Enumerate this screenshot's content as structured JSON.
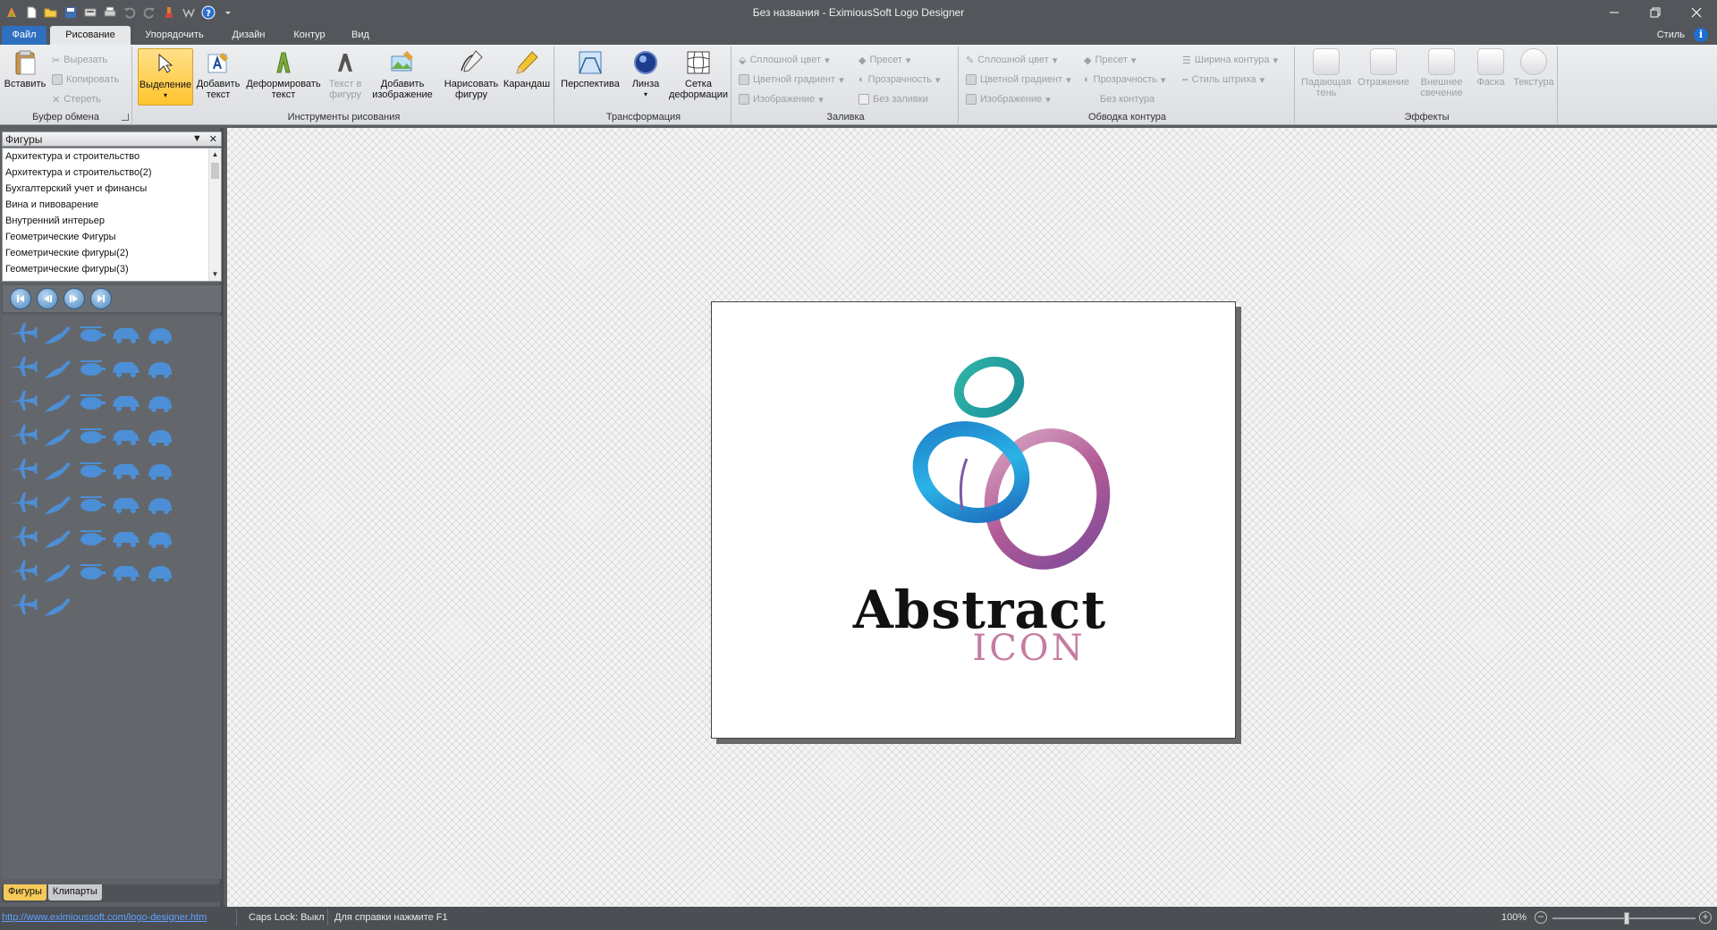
{
  "window": {
    "title": "Без названия - EximiousSoft Logo Designer",
    "controls": [
      "minimize-icon",
      "restore-icon",
      "close-icon"
    ]
  },
  "quick_access": [
    "app-logo-icon",
    "new-file-icon",
    "open-file-icon",
    "save-icon",
    "save-as-icon",
    "print-icon",
    "undo-icon",
    "redo-icon",
    "paint-icon",
    "web-icon",
    "help-icon",
    "qat-dropdown-icon"
  ],
  "tabs": {
    "file": "Файл",
    "items": [
      "Рисование",
      "Упорядочить",
      "Дизайн",
      "Контур",
      "Вид"
    ],
    "active": "Рисование",
    "style_menu": "Стиль"
  },
  "ribbon": {
    "clipboard": {
      "title": "Буфер обмена",
      "paste": "Вставить",
      "cut": "Вырезать",
      "copy": "Копировать",
      "delete": "Стереть"
    },
    "drawing": {
      "title": "Инструменты рисования",
      "select": "Выделение",
      "add_text": "Добавить текст",
      "warp_text": "Деформировать текст",
      "text_in_shape": "Текст в фигуру",
      "add_image": "Добавить изображение",
      "draw_shape": "Нарисовать фигуру",
      "pencil": "Карандаш"
    },
    "transform": {
      "title": "Трансформация",
      "perspective": "Перспектива",
      "lens": "Линза",
      "warp_grid": "Сетка деформации"
    },
    "fill": {
      "title": "Заливка",
      "solid": "Сплошной цвет",
      "gradient": "Цветной градиент",
      "image": "Изображение",
      "preset": "Пресет",
      "transparency": "Прозрачность",
      "no_fill": "Без заливки"
    },
    "stroke": {
      "title": "Обводка контура",
      "solid": "Сплошной цвет",
      "gradient": "Цветной градиент",
      "image": "Изображение",
      "preset": "Пресет",
      "transparency": "Прозрачность",
      "no_stroke": "Без контура",
      "width": "Ширина контура",
      "dash": "Стиль штриха"
    },
    "effects": {
      "title": "Эффекты",
      "shadow": "Падающая тень",
      "reflection": "Отражение",
      "glow": "Внешнее свечение",
      "bevel": "Фаска",
      "texture": "Текстура"
    }
  },
  "shapes_panel": {
    "title": "Фигуры",
    "categories": [
      "Архитектура и строительство",
      "Архитектура и строительство(2)",
      "Бухгалтерский учет и финансы",
      "Вина и пивоварение",
      "Внутренний интерьер",
      "Геометрические Фигуры",
      "Геометрические фигуры(2)",
      "Геометрические фигуры(3)"
    ],
    "nav": [
      "first-page-icon",
      "prev-page-icon",
      "next-page-icon",
      "last-page-icon"
    ],
    "shape_icons": [
      "airplane-icon",
      "jet-icon",
      "helicopter-icon",
      "car-icon",
      "car-side-icon",
      "car-front-icon",
      "car-round-icon",
      "motorcycle-icon",
      "scooter-icon",
      "car-box-icon",
      "tractor-icon",
      "paraglider-icon",
      "motorbike-icon",
      "biplane-icon",
      "truck-icon",
      "boat-icon",
      "airplane-small-icon",
      "motocross-icon",
      "bird-plane-icon",
      "gear-icon",
      "van-icon",
      "bus-icon",
      "lorry-icon",
      "sedan-icon",
      "biker-icon",
      "forklift-icon",
      "coach-icon",
      "fighter-jet-icon",
      "fish-plane-icon",
      "rocket-icon",
      "scuba-icon",
      "glider-icon",
      "bicycle-icon",
      "tram-icon",
      "ambulance-icon",
      "seaplane-icon",
      "parrot-icon",
      "ufo-icon",
      "ship-icon",
      "taxi-icon",
      "train-icon",
      "trolleybus-icon"
    ],
    "bottom_tabs": [
      "Фигуры",
      "Клипарты"
    ],
    "active_bottom_tab": "Фигуры"
  },
  "canvas": {
    "logo_text": "Abstract",
    "logo_subtext": "ICON"
  },
  "status": {
    "url": "http://www.eximioussoft.com/logo-designer.htm",
    "caps_lock": "Caps Lock: Выкл",
    "help": "Для справки нажмите F1",
    "zoom": "100%"
  }
}
